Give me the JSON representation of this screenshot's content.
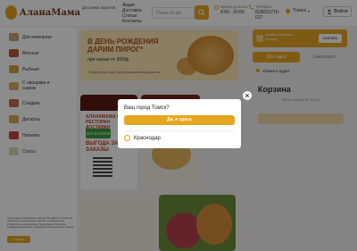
{
  "header": {
    "logo_text": "АланаМама",
    "tagline": "Доставка пирогов",
    "nav": [
      "Акции",
      "Доставка",
      "Статьи",
      "Контакты"
    ],
    "search_placeholder": "Поиск по ме",
    "hours_label": "Время работы",
    "hours_value": "8:00 - 20:00",
    "phone_label": "Телефон",
    "phone_value": "8(3822)715-017",
    "city": "Томск",
    "login_label": "Войти"
  },
  "sidebar": {
    "items": [
      {
        "label": "Для компании",
        "color": "#c9a36b"
      },
      {
        "label": "Мясные",
        "color": "#b65a3a"
      },
      {
        "label": "Рыбные",
        "color": "#cfa04a"
      },
      {
        "label": "С овощами и сыром",
        "color": "#d4b064"
      },
      {
        "label": "Сладкие",
        "color": "#c06b4a"
      },
      {
        "label": "Десерты",
        "color": "#d9a860"
      },
      {
        "label": "Напитки",
        "color": "#c8403a"
      },
      {
        "label": "Соусы",
        "color": "#e0d2b5"
      }
    ]
  },
  "banner": {
    "title": "В ДЕНЬ РОЖДЕНИЯ ДАРИМ ПИРОГ*",
    "subtitle": "при заказе от 3000р",
    "footnote": "*Подарочный пирог при предъявлении документа"
  },
  "promo1": {
    "title": "АЛАНАМАМА КЛУБ РЕСТОРАН ДОСТАВКИ",
    "badge": "300 БАЛЛОВ",
    "headline": "ВЫГОДА ЗА ЗАКАЗЫ"
  },
  "right_panel": {
    "bonus_text": "Приветственные бонусы",
    "bonus_button": "Скачать",
    "tab_delivery": "Доставка",
    "tab_pickup": "Самовывоз",
    "address": "Укажите адрес",
    "cart_title": "Корзина",
    "cart_empty": "Ваша корзина пуста"
  },
  "cookie": {
    "text": "Продолжая пользоваться сайтом, Вы даёте согласие на обработку персональных данных, сохранение на устройстве cookie-файлов. Подробнее в Политике конфиденциальности и обработке Персональных данных",
    "button": "Хорошо"
  },
  "modal": {
    "question": "Ваш город Томск?",
    "confirm_button": "Да, я здесь",
    "alt_city": "Краснодар"
  },
  "colors": {
    "accent": "#e5a521",
    "brand_dark": "#7a3a1a"
  }
}
